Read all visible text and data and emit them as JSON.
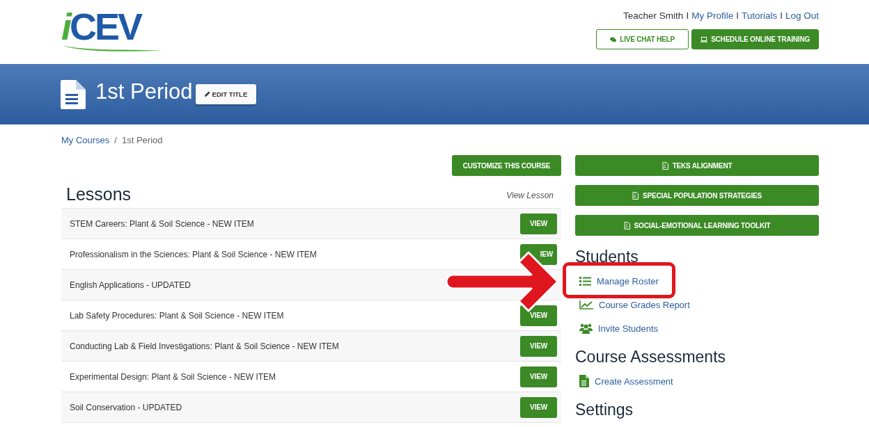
{
  "header": {
    "logo": {
      "first": "i",
      "rest": "CEV"
    },
    "user_bar": [
      {
        "kind": "text",
        "text": "Teacher Smith"
      },
      {
        "kind": "separator",
        "text": "I"
      },
      {
        "kind": "link",
        "text": "My Profile"
      },
      {
        "kind": "separator",
        "text": "I"
      },
      {
        "kind": "link",
        "text": "Tutorials"
      },
      {
        "kind": "separator",
        "text": "I"
      },
      {
        "kind": "link",
        "text": "Log Out"
      }
    ],
    "buttons": [
      {
        "label": "LIVE CHAT HELP",
        "kind": "outline"
      },
      {
        "label": "SCHEDULE ONLINE TRAINING",
        "kind": "solid"
      }
    ]
  },
  "banner": {
    "title": "1st Period",
    "edit_button": "EDIT TITLE"
  },
  "breadcrumb": {
    "items": [
      "My Courses",
      "1st Period"
    ],
    "separator": "/"
  },
  "lessons": {
    "customize_button": "CUSTOMIZE THIS COURSE",
    "heading": "Lessons",
    "column_label": "View Lesson",
    "rows": [
      {
        "title": "STEM Careers: Plant & Soil Science - NEW ITEM",
        "button": "VIEW"
      },
      {
        "title": "Professionalism in the Sciences: Plant & Soil Science - NEW ITEM",
        "button": "IEW"
      },
      {
        "title": "English Applications - UPDATED"
      },
      {
        "title": "Lab Safety Procedures: Plant & Soil Science - NEW ITEM",
        "button": "VIEW"
      },
      {
        "title": "Conducting Lab & Field Investigations: Plant & Soil Science - NEW ITEM",
        "button": "VIEW"
      },
      {
        "title": "Experimental Design: Plant & Soil Science - NEW ITEM",
        "button": "VIEW"
      },
      {
        "title": "Soil Conservation - UPDATED",
        "button": "VIEW"
      }
    ]
  },
  "sidebar": {
    "resource_buttons": [
      "TEKS ALIGNMENT",
      "SPECIAL POPULATION STRATEGIES",
      "SOCIAL-EMOTIONAL LEARNING TOOLKIT"
    ],
    "sections": [
      {
        "heading": "Students",
        "links": [
          {
            "label": "Manage Roster",
            "kind": "list",
            "highlighted": true
          },
          {
            "label": "Course Grades Report",
            "kind": "chart",
            "highlighted": false
          },
          {
            "label": "Invite Students",
            "kind": "users",
            "highlighted": false
          }
        ]
      },
      {
        "heading": "Course Assessments",
        "links": [
          {
            "label": "Create Assessment",
            "kind": "document",
            "highlighted": false
          }
        ]
      },
      {
        "heading": "Settings"
      }
    ]
  },
  "annotation": {
    "arrow": true
  }
}
